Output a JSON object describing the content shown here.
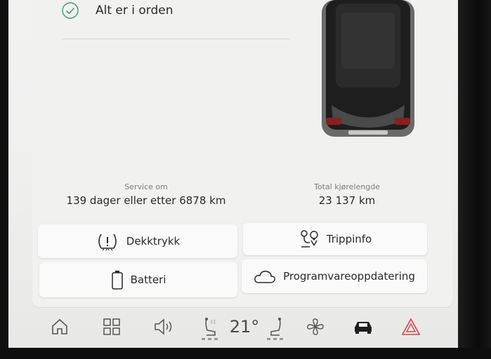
{
  "status": {
    "text": "Alt er i orden"
  },
  "service": {
    "label": "Service om",
    "value": "139 dager eller etter 6878 km"
  },
  "odometer": {
    "label": "Total kjørelengde",
    "value": "23 137 km"
  },
  "tiles": {
    "tire_pressure": "Dekktrykk",
    "trip_info": "Trippinfo",
    "battery": "Batteri",
    "software_update": "Programvareoppdatering"
  },
  "dock": {
    "temperature": "21°",
    "icons": [
      "home-icon",
      "apps-grid-icon",
      "volume-icon",
      "seat-heat-driver-icon",
      "seat-heat-passenger-icon",
      "fan-icon",
      "car-icon",
      "hazard-icon"
    ]
  },
  "colors": {
    "check": "#3f9e6a",
    "hazard": "#d64545",
    "text": "#2a2a2a"
  }
}
